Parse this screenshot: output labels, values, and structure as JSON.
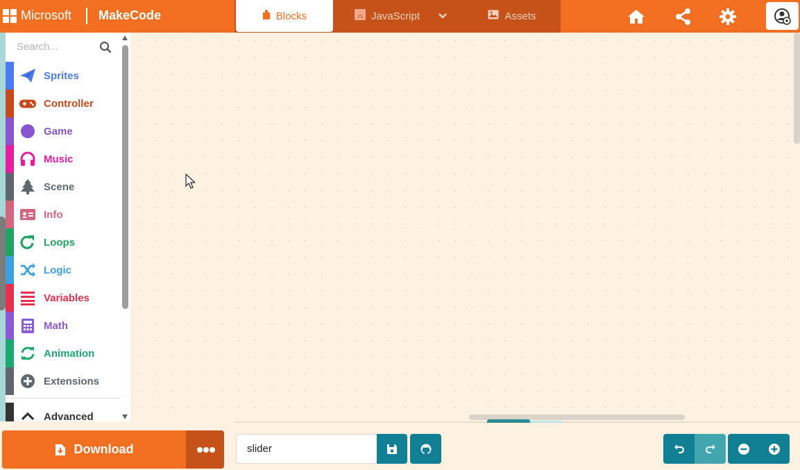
{
  "header": {
    "brand_ms": "Microsoft",
    "brand_mc": "MakeCode",
    "tabs": [
      {
        "label": "Blocks",
        "icon": "puzzle-icon",
        "active": true
      },
      {
        "label": "JavaScript",
        "icon": "js-icon",
        "active": false
      },
      {
        "label": "Assets",
        "icon": "image-icon",
        "active": false
      }
    ],
    "actions": [
      "home-icon",
      "share-icon",
      "gear-icon",
      "profile-icon"
    ],
    "accent": "#f26f21",
    "accent_dark": "#c65219"
  },
  "toolbox": {
    "search_placeholder": "Search...",
    "categories": [
      {
        "label": "Sprites",
        "color": "#4b7bec",
        "icon": "paper-plane-icon"
      },
      {
        "label": "Controller",
        "color": "#c6491c",
        "icon": "gamepad-icon"
      },
      {
        "label": "Game",
        "color": "#8854d0",
        "icon": "circle-icon"
      },
      {
        "label": "Music",
        "color": "#e51ea0",
        "icon": "headphones-icon"
      },
      {
        "label": "Scene",
        "color": "#5e6770",
        "icon": "tree-icon"
      },
      {
        "label": "Info",
        "color": "#d5657f",
        "icon": "id-card-icon"
      },
      {
        "label": "Loops",
        "color": "#20a464",
        "icon": "refresh-icon"
      },
      {
        "label": "Logic",
        "color": "#3aa0e0",
        "icon": "shuffle-icon"
      },
      {
        "label": "Variables",
        "color": "#e4304f",
        "icon": "list-icon"
      },
      {
        "label": "Math",
        "color": "#8b5ad8",
        "icon": "calculator-icon"
      },
      {
        "label": "Animation",
        "color": "#1ba96f",
        "icon": "sync-icon"
      },
      {
        "label": "Extensions",
        "color": "#5e6770",
        "icon": "plus-circle-icon"
      },
      {
        "label": "Advanced",
        "color": "#333333",
        "icon": "chevron-up-icon"
      }
    ]
  },
  "bottom": {
    "download_label": "Download",
    "project_name": "slider",
    "button_color": "#107f94"
  }
}
